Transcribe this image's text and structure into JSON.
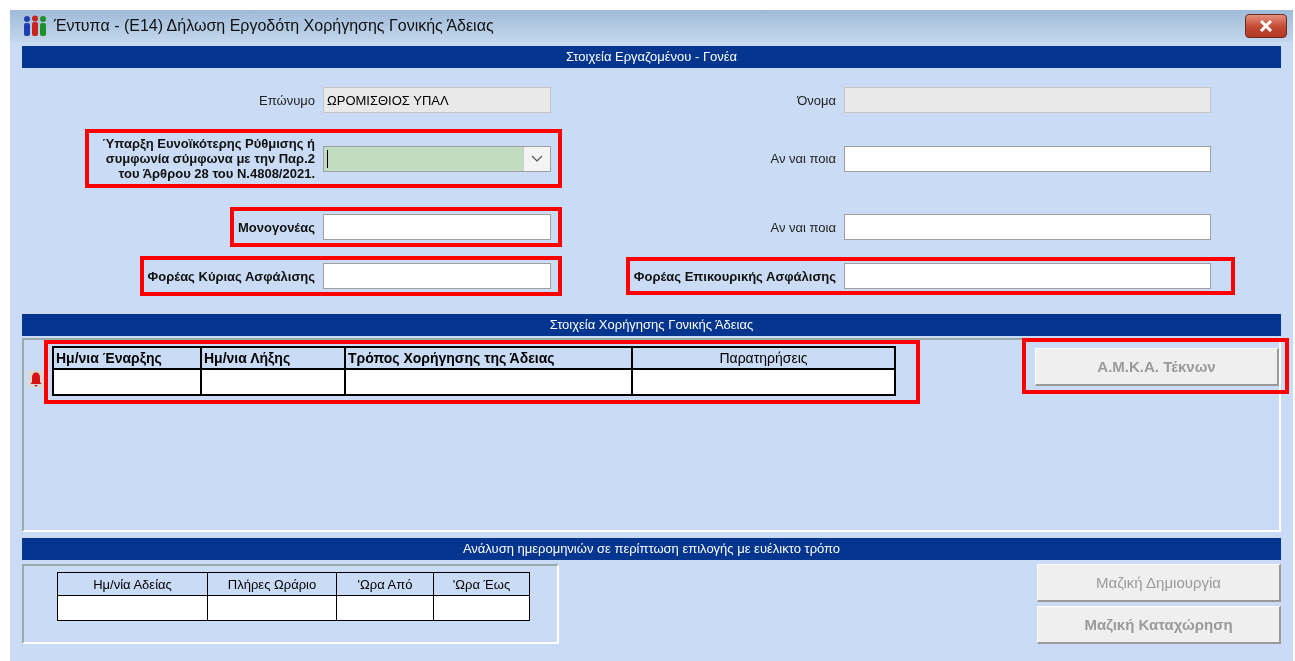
{
  "window": {
    "title": "Έντυπα - (Ε14) Δήλωση Εργοδότη Χορήγησης Γονικής Άδειας"
  },
  "employee_section": {
    "header": "Στοιχεία Εργαζομένου - Γονέα",
    "rows": [
      {
        "left": {
          "kind": "text",
          "label": "Επώνυμο",
          "value": "ΩΡΟΜΙΣΘΙΟΣ ΥΠΑΛ",
          "disabled": true,
          "required": false,
          "highlighted": false
        },
        "right": {
          "kind": "text",
          "label": "Όνομα",
          "disabled": true,
          "required": false,
          "highlighted": false
        }
      },
      {
        "left": {
          "kind": "dropdown",
          "label": "Ύπαρξη Ευνοϊκότερης Ρύθμισης ή συμφωνία σύμφωνα με την Παρ.2 του Άρθρου 28 του Ν.4808/2021.",
          "disabled": false,
          "required": true,
          "highlighted": true
        },
        "right": {
          "kind": "text",
          "label": "Αν ναι ποια",
          "disabled": false,
          "required": false,
          "highlighted": false
        }
      },
      {
        "left": {
          "kind": "text",
          "label": "Μονογονέας",
          "disabled": false,
          "required": true,
          "highlighted": true
        },
        "right": {
          "kind": "text",
          "label": "Αν ναι ποια",
          "disabled": false,
          "required": false,
          "highlighted": false
        }
      },
      {
        "left": {
          "kind": "text",
          "label": "Φορέας Κύριας Ασφάλισης",
          "disabled": false,
          "required": true,
          "highlighted": true
        },
        "right": {
          "kind": "text",
          "label": "Φορέας Επικουρικής Ασφάλισης",
          "disabled": false,
          "required": true,
          "highlighted": true
        }
      }
    ]
  },
  "leave_section": {
    "header": "Στοιχεία Χορήγησης Γονικής Άδειας",
    "table": {
      "highlighted": true,
      "columns": [
        {
          "label": "Ημ/νια Έναρξης",
          "bold": true
        },
        {
          "label": "Ημ/νια Λήξης",
          "bold": true
        },
        {
          "label": "Τρόπος Χορήγησης της Άδειας",
          "bold": true
        },
        {
          "label": "Παρατηρήσεις",
          "bold": false
        }
      ]
    },
    "buttons": [
      {
        "label": "Α.Μ.Κ.Α. Τέκνων",
        "bold": true,
        "disabled": true,
        "highlighted": true
      }
    ]
  },
  "dates_section": {
    "header": "Ανάλυση ημερομηνιών σε περίπτωση επιλογής με ευέλικτο τρόπο",
    "table": {
      "highlighted": false,
      "columns": [
        {
          "label": "Ημ/νία Αδείας",
          "bold": false
        },
        {
          "label": "Πλήρες Ωράριο",
          "bold": false
        },
        {
          "label": "'Ωρα Από",
          "bold": false
        },
        {
          "label": "'Ωρα Έως",
          "bold": false
        }
      ]
    },
    "buttons": [
      {
        "label": "Μαζική Δημιουργία",
        "bold": false,
        "disabled": true,
        "highlighted": false
      },
      {
        "label": "Μαζική Καταχώρηση",
        "bold": true,
        "disabled": true,
        "highlighted": false
      }
    ]
  }
}
